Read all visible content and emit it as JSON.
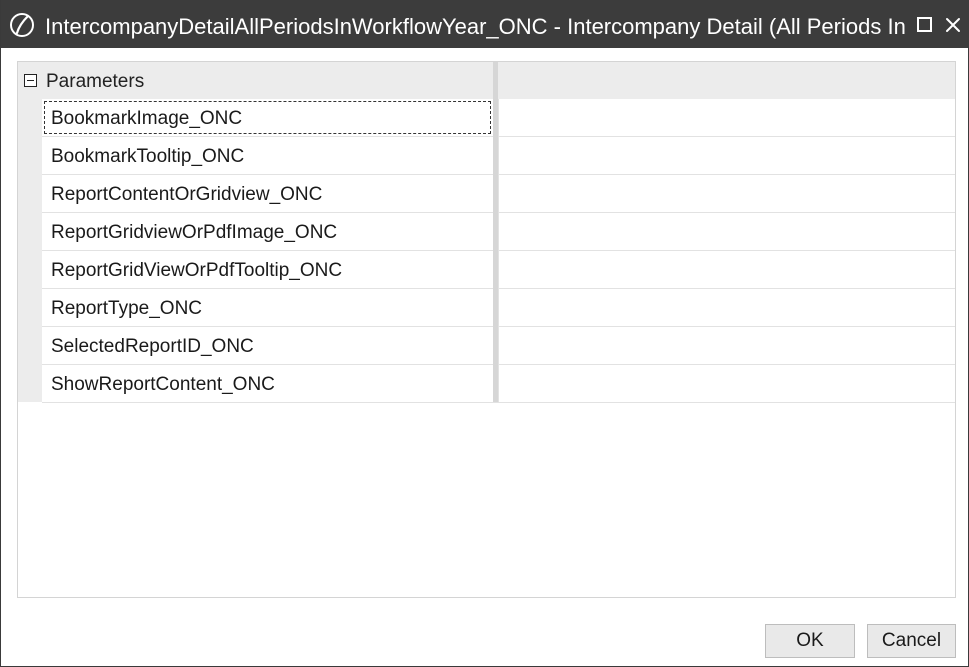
{
  "window": {
    "title": "IntercompanyDetailAllPeriodsInWorkflowYear_ONC - Intercompany Detail (All Periods In W",
    "titlebar_color": "#3c3c3c",
    "logo_icon": "onestream-logo-icon",
    "maximize_icon": "maximize-icon",
    "close_icon": "close-icon"
  },
  "property_grid": {
    "category": {
      "label": "Parameters",
      "expanded": true,
      "toggle_icon": "collapse-minus-icon"
    },
    "rows": [
      {
        "name": "BookmarkImage_ONC",
        "value": "",
        "selected": true
      },
      {
        "name": "BookmarkTooltip_ONC",
        "value": ""
      },
      {
        "name": "ReportContentOrGridview_ONC",
        "value": ""
      },
      {
        "name": "ReportGridviewOrPdfImage_ONC",
        "value": ""
      },
      {
        "name": "ReportGridViewOrPdfTooltip_ONC",
        "value": ""
      },
      {
        "name": "ReportType_ONC",
        "value": ""
      },
      {
        "name": "SelectedReportID_ONC",
        "value": ""
      },
      {
        "name": "ShowReportContent_ONC",
        "value": ""
      }
    ]
  },
  "buttons": {
    "ok_label": "OK",
    "cancel_label": "Cancel"
  }
}
